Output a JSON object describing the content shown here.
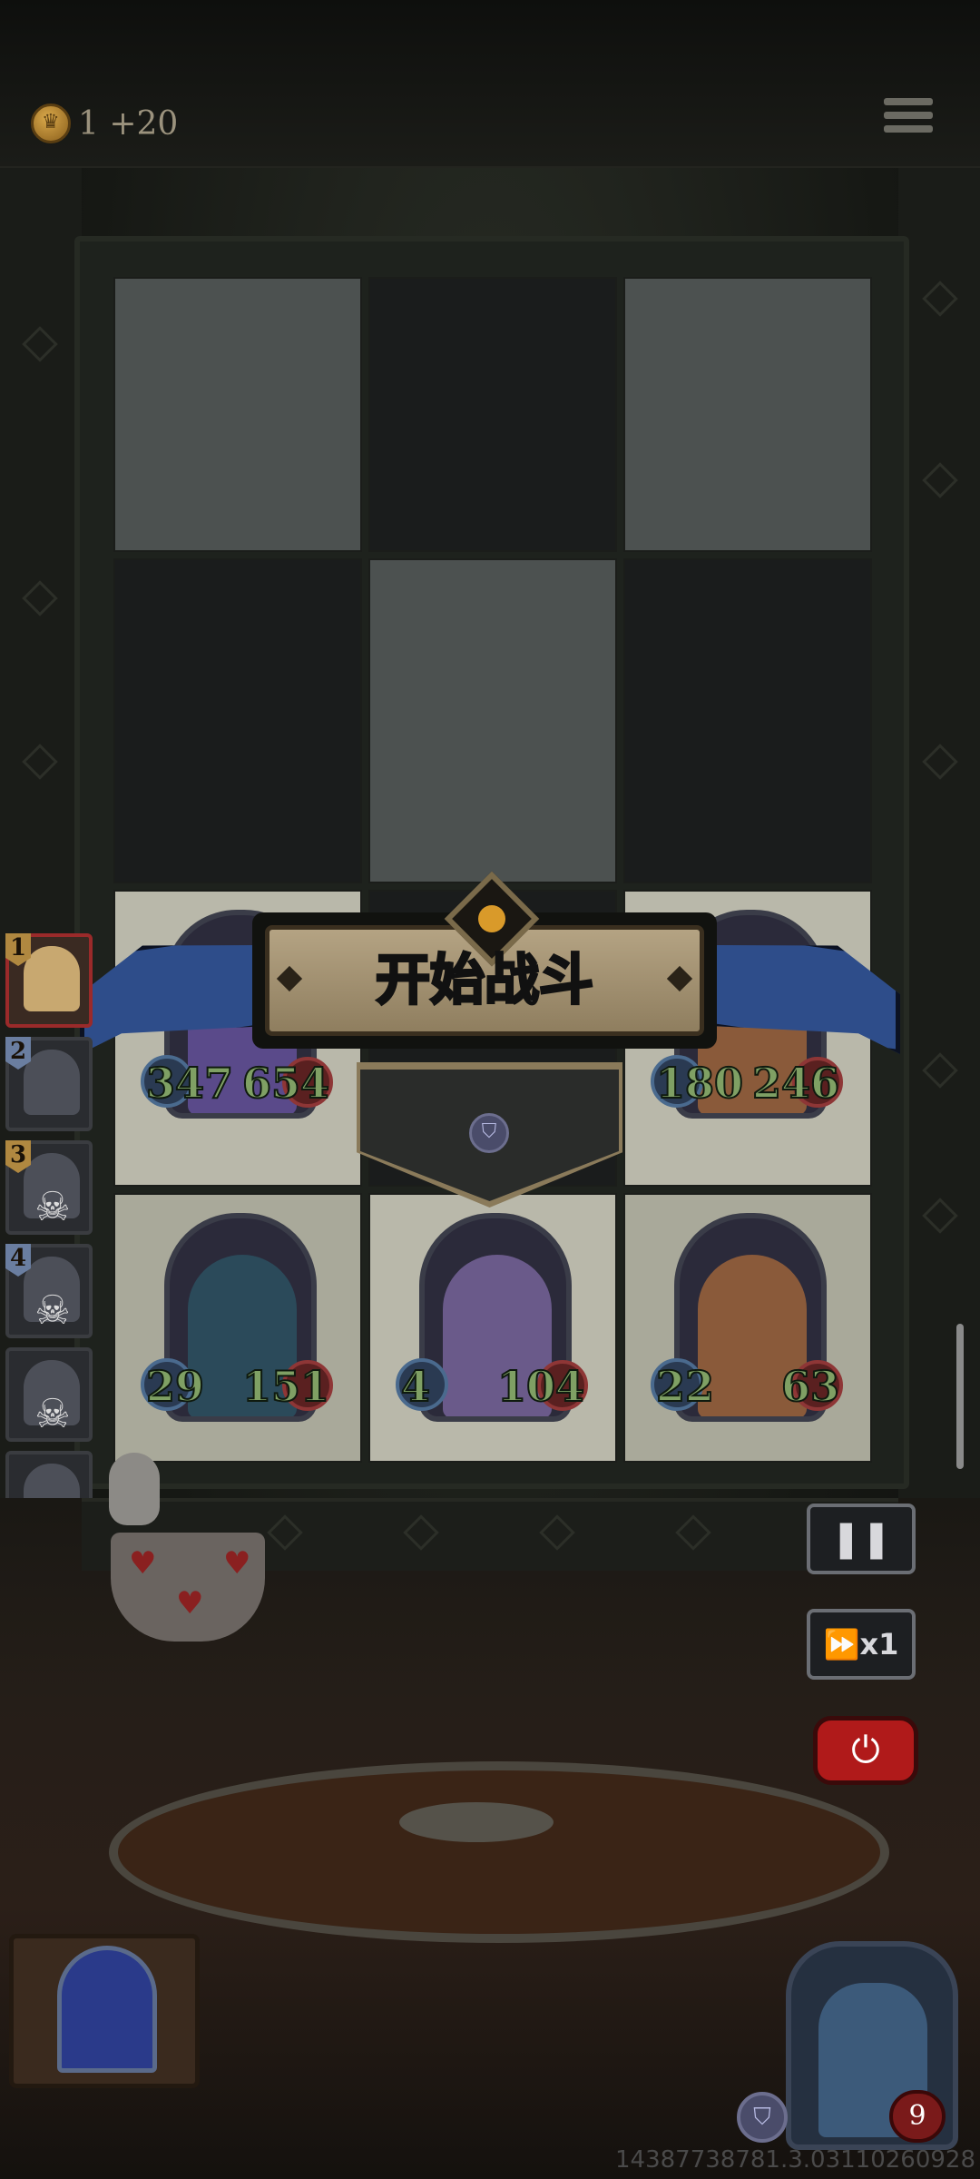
{
  "hud": {
    "gold_label": "1 +20",
    "menu_icon": "hamburger-menu-icon"
  },
  "banner": {
    "title": "开始战斗"
  },
  "board": {
    "ally_row_top": [
      {
        "atk": "347",
        "hp": "654",
        "portrait": "toad-icon",
        "color": "#5a4a8a"
      },
      null,
      {
        "atk": "180",
        "hp": "246",
        "portrait": "treant-icon",
        "color": "#8a5a3a"
      }
    ],
    "ally_row_bottom": [
      {
        "atk": "29",
        "hp": "151",
        "portrait": "elf-sorceress-icon",
        "color": "#2b4a5a"
      },
      {
        "atk": "4",
        "hp": "104",
        "portrait": "ghost-bride-icon",
        "color": "#6a5a8a"
      },
      {
        "atk": "22",
        "hp": "63",
        "portrait": "treant-icon",
        "color": "#8a5a3a"
      }
    ]
  },
  "turn_queue": [
    {
      "num": "1",
      "active": true,
      "defeated": false,
      "icon": "blonde-hero-icon"
    },
    {
      "num": "2",
      "active": false,
      "defeated": false,
      "icon": "blue-ghost-icon"
    },
    {
      "num": "3",
      "active": false,
      "defeated": true,
      "icon": "skull-icon"
    },
    {
      "num": "4",
      "active": false,
      "defeated": true,
      "icon": "skull-icon"
    },
    {
      "num": "",
      "active": false,
      "defeated": true,
      "icon": "skull-icon"
    },
    {
      "num": "",
      "active": false,
      "defeated": true,
      "icon": "skull-icon"
    },
    {
      "num": "",
      "active": false,
      "defeated": true,
      "icon": "skull-icon"
    },
    {
      "num": "",
      "active": false,
      "defeated": true,
      "icon": "skull-icon"
    }
  ],
  "controls": {
    "pause_glyph": "❚❚",
    "speed_label": "⏩x1",
    "power_glyph": "⏻"
  },
  "player": {
    "lives": "9",
    "shield_glyph": "⛉"
  },
  "build_id": "14387738781.3.03110260928"
}
